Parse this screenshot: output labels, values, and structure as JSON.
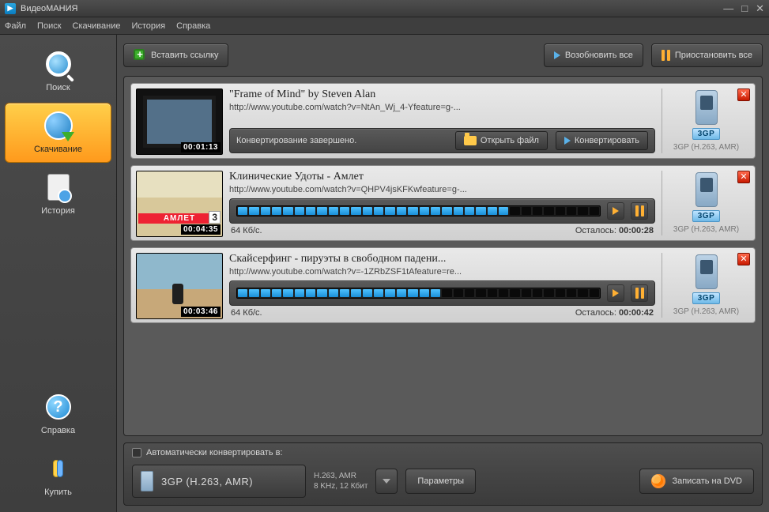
{
  "window": {
    "title": "ВидеоМАНИЯ"
  },
  "menu": {
    "items": [
      "Файл",
      "Поиск",
      "Скачивание",
      "История",
      "Справка"
    ]
  },
  "sidebar": {
    "top": [
      {
        "label": "Поиск",
        "name": "sidebar-item-search",
        "active": false
      },
      {
        "label": "Скачивание",
        "name": "sidebar-item-download",
        "active": true
      },
      {
        "label": "История",
        "name": "sidebar-item-history",
        "active": false
      }
    ],
    "bottom": [
      {
        "label": "Справка",
        "name": "sidebar-item-help"
      },
      {
        "label": "Купить",
        "name": "sidebar-item-buy"
      }
    ]
  },
  "toolbar": {
    "paste_link": "Вставить ссылку",
    "resume_all": "Возобновить все",
    "pause_all": "Приостановить все"
  },
  "downloads": [
    {
      "title": "\"Frame of Mind\" by Steven Alan",
      "url": "http://www.youtube.com/watch?v=NtAn_Wj_4-Yfeature=g-...",
      "time": "00:01:13",
      "state": "done",
      "status_text": "Конвертирование завершено.",
      "open_file": "Открыть файл",
      "convert": "Конвертировать",
      "format_badge": "3GP",
      "format_sub": "3GP (H.263, AMR)"
    },
    {
      "title": "Клинические Удоты - Амлет",
      "url": "http://www.youtube.com/watch?v=QHPV4jsKFKwfeature=g-...",
      "time": "00:04:35",
      "state": "progress",
      "speed": "64 Кб/с.",
      "remain_label": "Осталось:",
      "remain_value": "00:00:28",
      "progress_fill": 24,
      "progress_total": 32,
      "format_badge": "3GP",
      "format_sub": "3GP (H.263, AMR)",
      "thumb_label": "АМЛЕТ",
      "thumb_corner": "3"
    },
    {
      "title": "Скайсерфинг - пируэты в свободном падени...",
      "url": "http://www.youtube.com/watch?v=-1ZRbZSF1tAfeature=re...",
      "time": "00:03:46",
      "state": "progress",
      "speed": "64 Кб/с.",
      "remain_label": "Осталось:",
      "remain_value": "00:00:42",
      "progress_fill": 18,
      "progress_total": 32,
      "format_badge": "3GP",
      "format_sub": "3GP (H.263, AMR)"
    }
  ],
  "footer": {
    "auto_convert_label": "Автоматически конвертировать в:",
    "format_name": "3GP (H.263, AMR)",
    "format_line1": "H.263, AMR",
    "format_line2": "8 KHz, 12 Кбит",
    "params": "Параметры",
    "burn_dvd": "Записать на DVD"
  }
}
